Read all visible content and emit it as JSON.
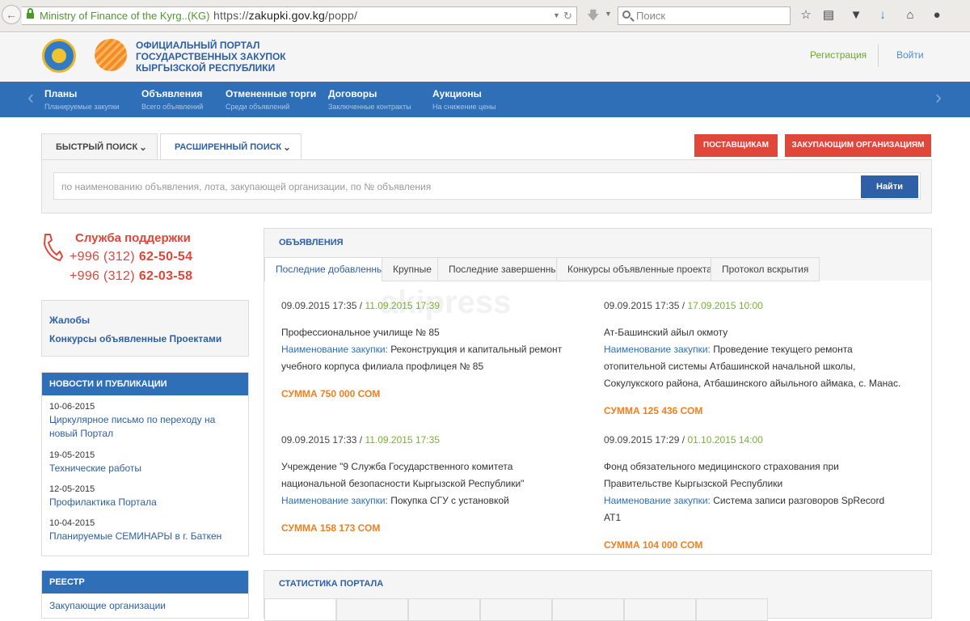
{
  "browser": {
    "site_identity": "Ministry of Finance of the Kyrg...",
    "site_country": "(KG)",
    "url_scheme": "https://",
    "url_host": "zakupki.gov.kg",
    "url_path": "/popp/",
    "search_placeholder": "Поиск"
  },
  "header": {
    "portal_title_1": "ОФИЦИАЛЬНЫЙ ПОРТАЛ",
    "portal_title_2": "ГОСУДАРСТВЕННЫХ ЗАКУПОК",
    "portal_title_3": "КЫРГЫЗСКОЙ РЕСПУБЛИКИ",
    "register": "Регистрация",
    "login": "Войти"
  },
  "nav": {
    "items": [
      {
        "title": "Планы",
        "sub": "Планируемые закупки"
      },
      {
        "title": "Объявления",
        "sub": "Всего объявлений"
      },
      {
        "title": "Отмененные торги",
        "sub": "Среди объявлений"
      },
      {
        "title": "Договоры",
        "sub": "Заключенные контракты"
      },
      {
        "title": "Аукционы",
        "sub": "На снижение цены"
      }
    ]
  },
  "search": {
    "quick_tab": "БЫСТРЫЙ ПОИСК",
    "advanced_tab": "РАСШИРЕННЫЙ ПОИСК",
    "suppliers_btn": "ПОСТАВЩИКАМ",
    "orgs_btn": "ЗАКУПАЮЩИМ ОРГАНИЗАЦИЯМ",
    "placeholder": "по наименованию объявления, лота, закупающей организации, по № объявления",
    "find_btn": "Найти"
  },
  "support": {
    "title": "Служба поддержки",
    "phone1_code": "+996 (312)",
    "phone1_num": "62-50-54",
    "phone2_code": "+996 (312)",
    "phone2_num": "62-03-58"
  },
  "links": {
    "complaints": "Жалобы",
    "projects": "Конкурсы объявленные Проектами"
  },
  "news": {
    "title": "НОВОСТИ И ПУБЛИКАЦИИ",
    "items": [
      {
        "date": "10-06-2015",
        "title": "Циркулярное письмо по переходу на новый Портал"
      },
      {
        "date": "19-05-2015",
        "title": "Технические работы"
      },
      {
        "date": "12-05-2015",
        "title": "Профилактика Портала"
      },
      {
        "date": "10-04-2015",
        "title": "Планируемые СЕМИНАРЫ в г. Баткен"
      }
    ]
  },
  "registry": {
    "title": "РЕЕСТР",
    "first_item": "Закупающие организации"
  },
  "announcements": {
    "title": "ОБЪЯВЛЕНИЯ",
    "watermark": "akipress",
    "tabs": [
      "Последние добавленные",
      "Крупные",
      "Последние завершенные",
      "Конкурсы объявленные проектами",
      "Протокол вскрытия"
    ],
    "subject_label": "Наименование закупки:",
    "cards": [
      {
        "published": "09.09.2015 17:35",
        "deadline": "11.09.2015 17:39",
        "org": "Профессиональное училище № 85",
        "subject": " Реконструкция и капитальный ремонт учебного корпуса филиала профлицея № 85",
        "sum": "СУММА 750 000 СОМ"
      },
      {
        "published": "09.09.2015 17:35",
        "deadline": "17.09.2015 10:00",
        "org": "Ат-Башинский айыл окмоту",
        "subject": " Проведение текущего ремонта отопительной системы Атбашинской начальной школы, Сокулукского района, Атбашинского айыльного аймака, с. Манас.",
        "sum": "СУММА 125 436 СОМ"
      },
      {
        "published": "09.09.2015 17:33",
        "deadline": "11.09.2015 17:35",
        "org": "Учреждение \"9 Служба Государственного комитета национальной безопасности Кыргызской Республики\"",
        "subject": " Покупка СГУ с установкой",
        "sum": "СУММА 158 173 СОМ"
      },
      {
        "published": "09.09.2015 17:29",
        "deadline": "01.10.2015 14:00",
        "org": "Фонд обязательного медицинского страхования при Правительстве Кыргызской Республики",
        "subject": " Система записи разговоров SpRecord AT1",
        "sum": "СУММА 104 000 СОМ"
      }
    ]
  },
  "stats": {
    "title": "СТАТИСТИКА ПОРТАЛА"
  }
}
